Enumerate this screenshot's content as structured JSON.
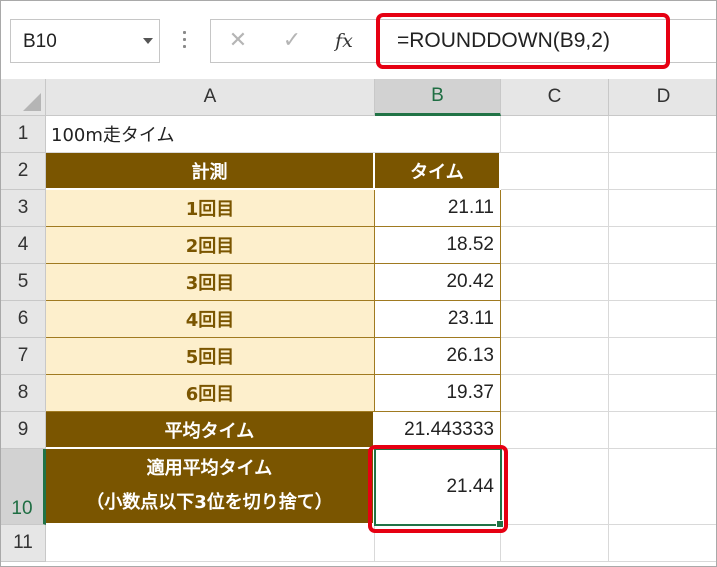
{
  "formula_bar": {
    "name_box": "B10",
    "cancel_glyph": "✕",
    "enter_glyph": "✓",
    "fx_label": "fx",
    "formula": "=ROUNDDOWN(B9,2)"
  },
  "columns": [
    "A",
    "B",
    "C",
    "D"
  ],
  "selected_column": "B",
  "rows": [
    "1",
    "2",
    "3",
    "4",
    "5",
    "6",
    "7",
    "8",
    "9",
    "10",
    "11"
  ],
  "selected_row": "10",
  "sheet": {
    "title": "100m走タイム",
    "header_label": "計測",
    "header_time": "タイム",
    "entries": [
      {
        "label": "1回目",
        "time": "21.11"
      },
      {
        "label": "2回目",
        "time": "18.52"
      },
      {
        "label": "3回目",
        "time": "20.42"
      },
      {
        "label": "4回目",
        "time": "23.11"
      },
      {
        "label": "5回目",
        "time": "26.13"
      },
      {
        "label": "6回目",
        "time": "19.37"
      }
    ],
    "average_label": "平均タイム",
    "average_value": "21.443333",
    "applied_label_line1": "適用平均タイム",
    "applied_label_line2": "（小数点以下3位を切り捨て）",
    "applied_value": "21.44"
  },
  "colors": {
    "header_fill": "#7a5500",
    "label_fill": "#fdefcc",
    "highlight": "#e60012",
    "selection": "#217346"
  }
}
